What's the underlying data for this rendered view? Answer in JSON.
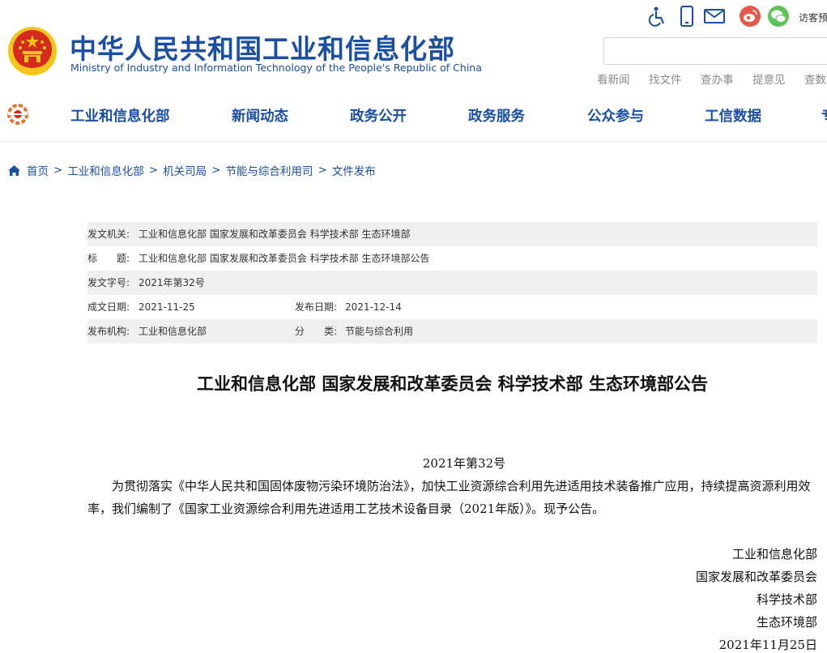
{
  "header": {
    "title": "中华人民共和国工业和信息化部",
    "subtitle": "Ministry of Industry and Information Technology of the People's Republic of China",
    "icons": [
      "accessibility-icon",
      "mobile-icon",
      "mail-icon",
      "weibo-icon",
      "wechat-icon"
    ],
    "visitor_label": "访客预",
    "search_placeholder": "",
    "quick_links": [
      "看新闻",
      "找文件",
      "查办事",
      "提意见",
      "查数"
    ]
  },
  "nav": {
    "items": [
      "工业和信息化部",
      "新闻动态",
      "政务公开",
      "政务服务",
      "公众参与",
      "工信数据",
      "专"
    ]
  },
  "breadcrumb": {
    "items": [
      "首页",
      "工业和信息化部",
      "机关司局",
      "节能与综合利用司",
      "文件发布"
    ],
    "separator": ">"
  },
  "info": {
    "issuer_label": "发文机关:",
    "issuer": "工业和信息化部 国家发展和改革委员会 科学技术部 生态环境部",
    "title_label": "标　　题:",
    "title": "工业和信息化部 国家发展和改革委员会 科学技术部 生态环境部公告",
    "docno_label": "发文字号:",
    "docno": "2021年第32号",
    "created_label": "成文日期:",
    "created": "2021-11-25",
    "published_label": "发布日期:",
    "published": "2021-12-14",
    "org_label": "发布机构:",
    "org": "工业和信息化部",
    "category_label": "分　　类:",
    "category": "节能与综合利用"
  },
  "article": {
    "title": "工业和信息化部 国家发展和改革委员会 科学技术部 生态环境部公告",
    "number": "2021年第32号",
    "body": "为贯彻落实《中华人民共和国固体废物污染环境防治法》，加快工业资源综合利用先进适用技术装备推广应用，持续提高资源利用效率，我们编制了《国家工业资源综合利用先进适用工艺技术设备目录（2021年版）》。现予公告。",
    "signatures": [
      "工业和信息化部",
      "国家发展和改革委员会",
      "科学技术部",
      "生态环境部"
    ],
    "date": "2021年11月25日"
  },
  "colors": {
    "brand_blue": "#1a4fa3",
    "emblem_red": "#d52b1e",
    "emblem_gold": "#f5c518",
    "weibo_red": "#e6584a",
    "wechat_green": "#5fc35a",
    "row_shade": "#f0f0f0"
  }
}
